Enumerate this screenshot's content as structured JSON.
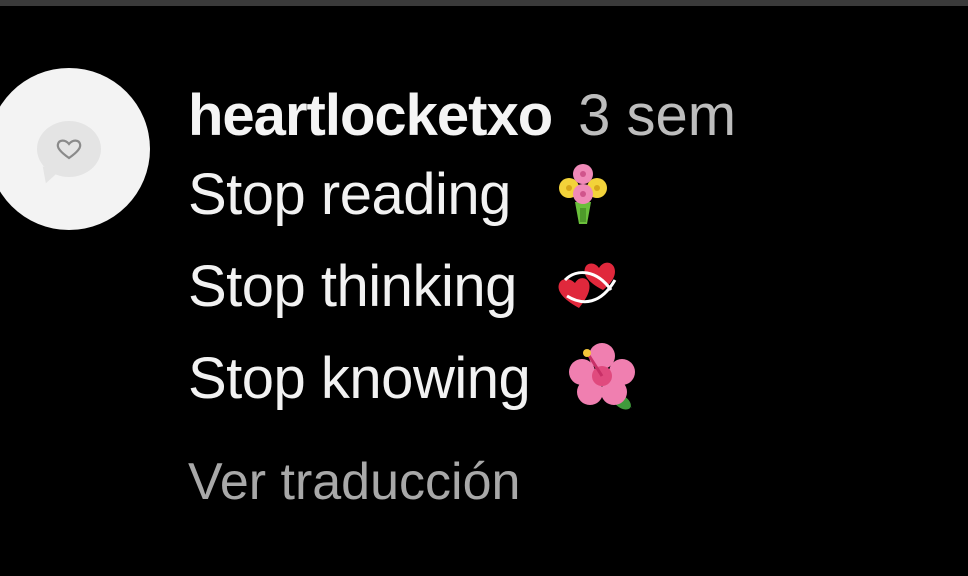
{
  "comment": {
    "username": "heartlocketxo",
    "timestamp": "3 sem",
    "lines": [
      {
        "text": "Stop reading",
        "emoji": "bouquet-icon"
      },
      {
        "text": "Stop thinking",
        "emoji": "two-hearts-icon"
      },
      {
        "text": "Stop knowing",
        "emoji": "hibiscus-icon"
      }
    ],
    "translate_label": "Ver traducción"
  },
  "colors": {
    "background": "#000000",
    "text_primary": "#f2f2f2",
    "text_secondary": "#a8a8a8",
    "avatar_bg": "#f3f3f3"
  }
}
